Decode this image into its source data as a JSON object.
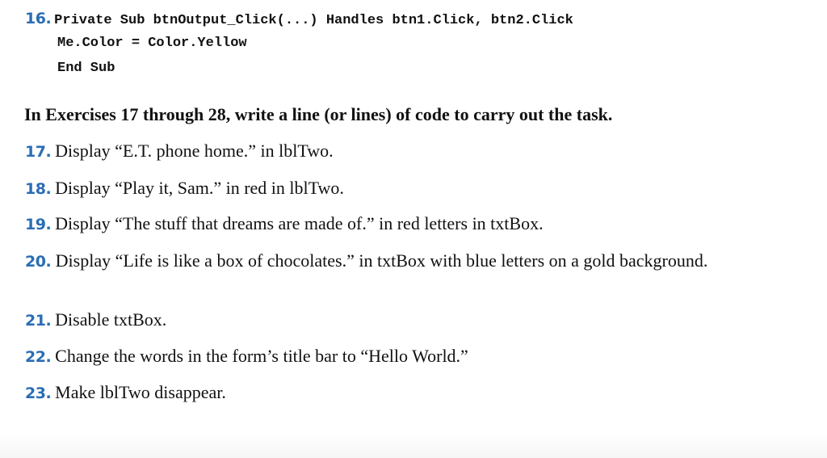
{
  "code_exercise": {
    "number": "16.",
    "lines": [
      "Private Sub btnOutput_Click(...) Handles btn1.Click, btn2.Click",
      "  Me.Color = Color.Yellow",
      "End Sub"
    ]
  },
  "instructions": "In Exercises 17 through 28, write a line (or lines) of code to carry out the task.",
  "exercises": [
    {
      "number": "17.",
      "text": "Display “E.T. phone home.” in lblTwo."
    },
    {
      "number": "18.",
      "text": "Display “Play it, Sam.” in red in lblTwo."
    },
    {
      "number": "19.",
      "text": "Display “The stuff that dreams are made of.” in red letters in txtBox."
    },
    {
      "number": "20.",
      "text": "Display “Life is like a box of chocolates.” in txtBox with blue letters on a gold background."
    },
    {
      "number": "21.",
      "text": "Disable txtBox."
    },
    {
      "number": "22.",
      "text": "Change the words in the form’s title bar to “Hello World.”"
    },
    {
      "number": "23.",
      "text": "Make lblTwo disappear."
    }
  ],
  "colors": {
    "exercise_number": "#2a6db5",
    "text": "#111111"
  }
}
